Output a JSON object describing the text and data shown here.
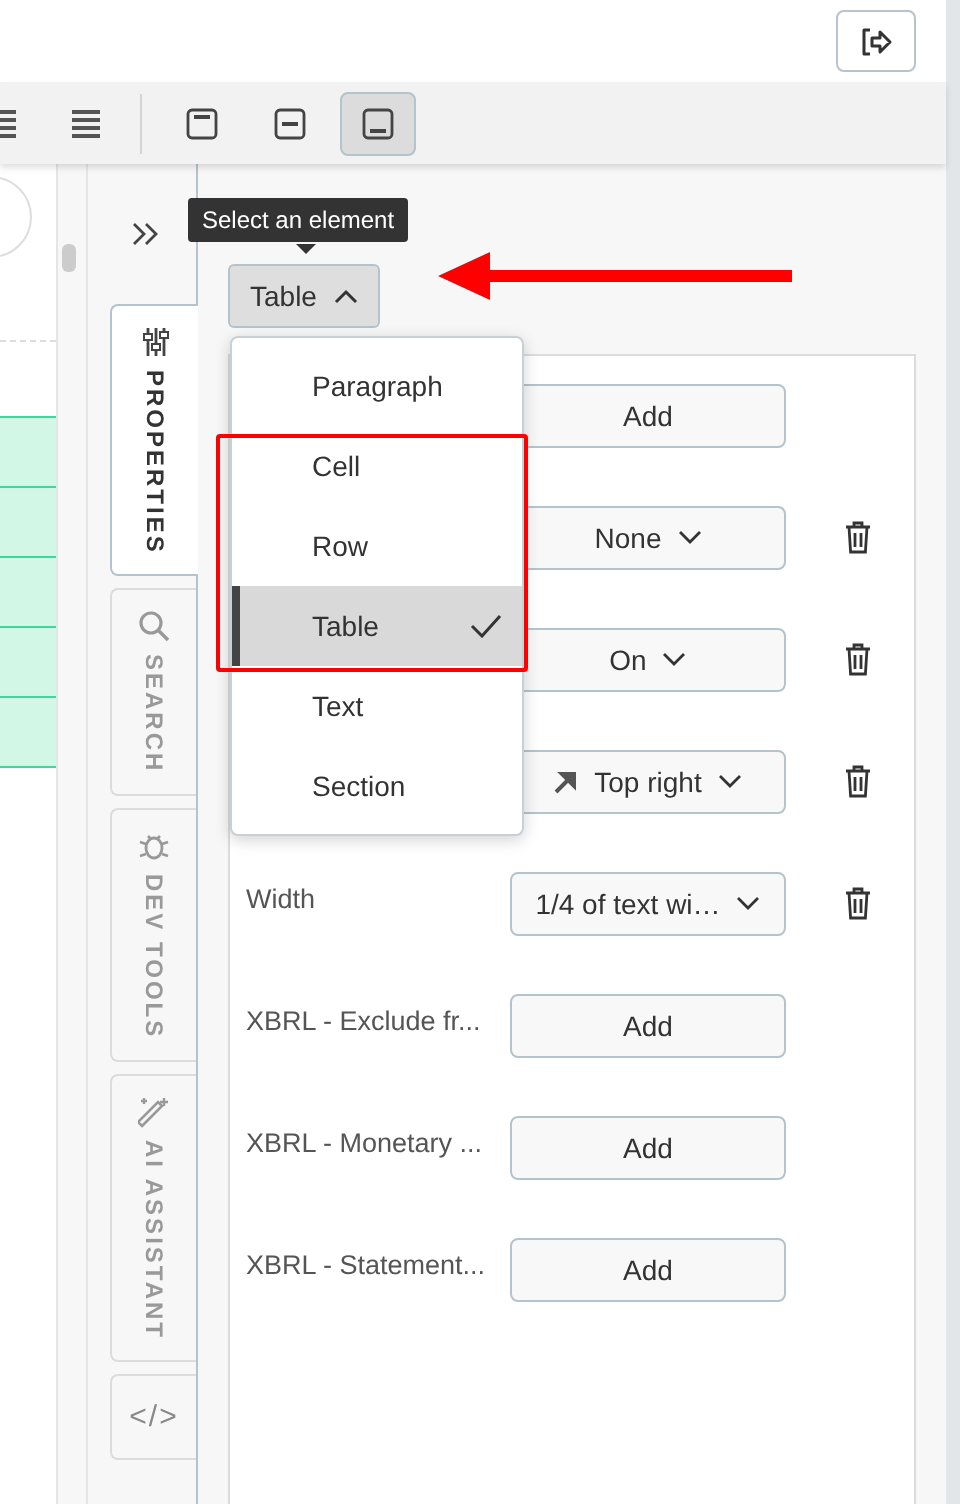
{
  "toolbar": {
    "vertical_align_buttons": [
      {
        "selected": false
      },
      {
        "selected": false
      },
      {
        "selected": true
      }
    ]
  },
  "sidebar": {
    "tabs": [
      {
        "kind": "properties",
        "label": "PROPERTIES",
        "selected": true
      },
      {
        "kind": "search",
        "label": "SEARCH",
        "selected": false
      },
      {
        "kind": "devtools",
        "label": "DEV TOOLS",
        "selected": false
      },
      {
        "kind": "ai",
        "label": "AI ASSISTANT",
        "selected": false
      },
      {
        "kind": "code",
        "label": "</>",
        "selected": false
      }
    ]
  },
  "panel": {
    "tooltip": "Select an element",
    "element_selector": {
      "value": "Table",
      "expanded": true
    },
    "element_menu": [
      {
        "label": "Paragraph",
        "selected": false
      },
      {
        "label": "Cell",
        "selected": false
      },
      {
        "label": "Row",
        "selected": false
      },
      {
        "label": "Table",
        "selected": true
      },
      {
        "label": "Text",
        "selected": false
      },
      {
        "label": "Section",
        "selected": false
      }
    ],
    "properties": [
      {
        "kind": "button",
        "value": "Add",
        "removable": false
      },
      {
        "kind": "select",
        "value": "None",
        "removable": true
      },
      {
        "kind": "select",
        "value": "On",
        "removable": true
      },
      {
        "kind": "direction_select",
        "value": "Top right",
        "removable": true
      },
      {
        "kind": "select",
        "label": "Width",
        "value": "1/4 of text wi…",
        "removable": true
      },
      {
        "kind": "button",
        "label": "XBRL - Exclude fr...",
        "value": "Add",
        "removable": false
      },
      {
        "kind": "button",
        "label": "XBRL - Monetary ...",
        "value": "Add",
        "removable": false
      },
      {
        "kind": "button",
        "label": "XBRL - Statement...",
        "value": "Add",
        "removable": false
      }
    ]
  }
}
